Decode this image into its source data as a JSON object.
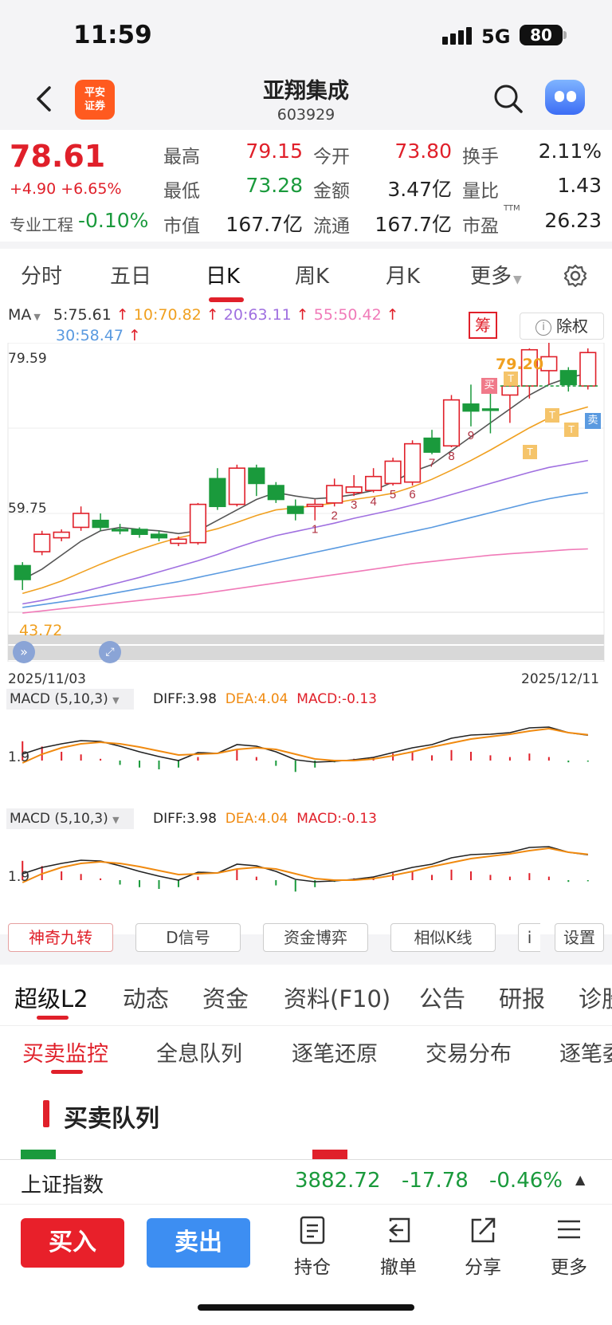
{
  "status": {
    "time": "11:59",
    "network": "5G",
    "battery": "80"
  },
  "header": {
    "logo_text_1": "平安",
    "logo_text_2": "证券",
    "stock_name": "亚翔集成",
    "stock_code": "603929"
  },
  "quote": {
    "price": "78.61",
    "change": "+4.90 +6.65%",
    "pro_label": "专业工程",
    "pro_value": "-0.10%",
    "fields": [
      {
        "label": "最高",
        "value": "79.15"
      },
      {
        "label": "今开",
        "value": "73.80"
      },
      {
        "label": "换手",
        "value": "2.11%"
      },
      {
        "label": "最低",
        "value": "73.28"
      },
      {
        "label": "金额",
        "value": "3.47亿"
      },
      {
        "label": "量比",
        "value": "1.43"
      },
      {
        "label": "市值",
        "value": "167.7亿"
      },
      {
        "label": "流通",
        "value": "167.7亿"
      },
      {
        "label": "市盈",
        "value": "26.23"
      }
    ],
    "ttm": "TTM"
  },
  "period_tabs": [
    "分时",
    "五日",
    "日K",
    "周K",
    "月K",
    "更多"
  ],
  "ma": {
    "label": "MA",
    "ma5": "5:75.61",
    "ma10": "10:70.82",
    "ma20": "20:63.11",
    "ma55": "55:50.42",
    "ma30": "30:58.47",
    "colors": {
      "ma5": "#555555",
      "ma10": "#f0a020",
      "ma20": "#a070e0",
      "ma55": "#f07ab8",
      "ma30": "#5a9ae0"
    }
  },
  "chart_buttons": {
    "chou": "筹",
    "chuquan": "除权"
  },
  "chart_data": {
    "type": "candlestick",
    "y_ticks": [
      "79.59",
      "59.75"
    ],
    "start_date": "2025/11/03",
    "end_date": "2025/12/11",
    "marks": {
      "high_label": "79.20",
      "low_label": "43.72",
      "buy": "买",
      "sell": "卖",
      "t": "T"
    },
    "count_labels": [
      "1",
      "2",
      "3",
      "4",
      "5",
      "6",
      "7",
      "8",
      "9"
    ],
    "candles": [
      {
        "o": 48.0,
        "c": 46.0,
        "h": 48.5,
        "l": 44.5
      },
      {
        "o": 50.0,
        "c": 52.5,
        "h": 53.0,
        "l": 49.5
      },
      {
        "o": 52.0,
        "c": 52.8,
        "h": 53.2,
        "l": 51.5
      },
      {
        "o": 53.5,
        "c": 55.5,
        "h": 56.5,
        "l": 53.0
      },
      {
        "o": 54.5,
        "c": 53.5,
        "h": 55.5,
        "l": 53.0
      },
      {
        "o": 53.2,
        "c": 53.0,
        "h": 54.0,
        "l": 52.5
      },
      {
        "o": 53.2,
        "c": 52.5,
        "h": 53.5,
        "l": 52.0
      },
      {
        "o": 52.5,
        "c": 52.0,
        "h": 53.0,
        "l": 51.5
      },
      {
        "o": 51.2,
        "c": 51.8,
        "h": 52.2,
        "l": 50.8
      },
      {
        "o": 51.3,
        "c": 56.8,
        "h": 57.0,
        "l": 51.0
      },
      {
        "o": 60.5,
        "c": 56.5,
        "h": 62.0,
        "l": 56.0
      },
      {
        "o": 56.8,
        "c": 62.0,
        "h": 62.5,
        "l": 56.5
      },
      {
        "o": 62.0,
        "c": 59.8,
        "h": 62.5,
        "l": 58.0
      },
      {
        "o": 59.5,
        "c": 57.5,
        "h": 60.0,
        "l": 57.0
      },
      {
        "o": 56.5,
        "c": 55.5,
        "h": 57.5,
        "l": 54.5
      },
      {
        "o": 56.5,
        "c": 56.8,
        "h": 57.5,
        "l": 54.5
      },
      {
        "o": 57.0,
        "c": 59.5,
        "h": 60.5,
        "l": 56.5
      },
      {
        "o": 58.5,
        "c": 59.3,
        "h": 61.0,
        "l": 58.0
      },
      {
        "o": 58.8,
        "c": 60.8,
        "h": 62.0,
        "l": 58.5
      },
      {
        "o": 59.8,
        "c": 63.0,
        "h": 63.5,
        "l": 59.5
      },
      {
        "o": 60.0,
        "c": 65.5,
        "h": 66.0,
        "l": 59.5
      },
      {
        "o": 66.3,
        "c": 64.3,
        "h": 67.5,
        "l": 64.0
      },
      {
        "o": 65.2,
        "c": 71.8,
        "h": 72.5,
        "l": 65.0
      },
      {
        "o": 71.2,
        "c": 70.2,
        "h": 74.0,
        "l": 68.0
      },
      {
        "o": 70.5,
        "c": 70.3,
        "h": 73.0,
        "l": 67.0
      },
      {
        "o": 72.5,
        "c": 73.8,
        "h": 74.5,
        "l": 68.5
      },
      {
        "o": 73.8,
        "c": 79.0,
        "h": 79.2,
        "l": 72.0
      },
      {
        "o": 76.0,
        "c": 78.0,
        "h": 80.0,
        "l": 74.0
      },
      {
        "o": 76.0,
        "c": 74.0,
        "h": 76.5,
        "l": 73.0
      },
      {
        "o": 73.8,
        "c": 78.6,
        "h": 79.2,
        "l": 73.3
      }
    ],
    "ma_series": {
      "ma5": [
        46,
        47.5,
        49.5,
        51.5,
        53.0,
        53.5,
        53.2,
        53.0,
        52.6,
        53.0,
        54.5,
        56.0,
        57.5,
        58.5,
        58.0,
        57.6,
        57.8,
        58.2,
        58.8,
        60.0,
        61.5,
        62.5,
        64.5,
        66.5,
        68.5,
        70.5,
        72.5,
        74.0,
        75.0,
        75.6
      ],
      "ma10": [
        44,
        44.8,
        45.8,
        47.0,
        48.2,
        49.3,
        50.3,
        51.2,
        52.0,
        52.6,
        53.3,
        54.2,
        55.2,
        56.0,
        56.3,
        56.6,
        57.0,
        57.5,
        57.9,
        58.4,
        59.3,
        60.4,
        61.7,
        63.1,
        64.6,
        66.2,
        67.8,
        69.2,
        70.0,
        70.8
      ],
      "ma20": [
        42.5,
        43.0,
        43.6,
        44.2,
        44.9,
        45.6,
        46.3,
        47.1,
        47.9,
        48.7,
        49.6,
        50.6,
        51.5,
        52.3,
        52.9,
        53.5,
        54.1,
        54.8,
        55.4,
        56.0,
        56.7,
        57.4,
        58.2,
        59.0,
        59.8,
        60.6,
        61.4,
        62.1,
        62.6,
        63.1
      ],
      "ma30": [
        42.0,
        42.4,
        42.8,
        43.2,
        43.7,
        44.2,
        44.7,
        45.2,
        45.7,
        46.3,
        46.9,
        47.5,
        48.1,
        48.7,
        49.3,
        49.9,
        50.5,
        51.1,
        51.7,
        52.3,
        52.9,
        53.5,
        54.2,
        54.9,
        55.6,
        56.3,
        57.0,
        57.6,
        58.1,
        58.5
      ],
      "ma55": [
        41.2,
        41.5,
        41.8,
        42.1,
        42.4,
        42.7,
        43.0,
        43.3,
        43.6,
        43.9,
        44.3,
        44.7,
        45.1,
        45.5,
        45.9,
        46.3,
        46.7,
        47.1,
        47.5,
        47.9,
        48.3,
        48.6,
        48.9,
        49.2,
        49.5,
        49.7,
        49.9,
        50.1,
        50.3,
        50.4
      ]
    }
  },
  "macd": {
    "label": "MACD (5,10,3)",
    "diff": "DIFF:3.98",
    "dea": "DEA:4.04",
    "macd": "MACD:-0.13",
    "axis_label": "1.9",
    "diff_series": [
      1.6,
      2.4,
      2.9,
      3.3,
      3.2,
      2.6,
      1.9,
      1.3,
      0.8,
      1.8,
      1.7,
      2.8,
      2.6,
      1.9,
      0.9,
      0.6,
      0.7,
      0.9,
      1.2,
      1.8,
      2.4,
      2.8,
      3.6,
      4.0,
      4.1,
      4.3,
      4.9,
      5.0,
      4.3,
      3.98
    ],
    "dea_series": [
      0.5,
      1.6,
      2.4,
      2.9,
      3.1,
      2.9,
      2.5,
      2.0,
      1.5,
      1.6,
      1.7,
      2.2,
      2.4,
      2.2,
      1.6,
      1.0,
      0.8,
      0.8,
      1.0,
      1.4,
      1.9,
      2.5,
      3.0,
      3.5,
      3.8,
      4.1,
      4.5,
      4.8,
      4.3,
      4.04
    ],
    "hist": [
      2.2,
      1.6,
      1.0,
      0.7,
      0.2,
      -0.5,
      -0.8,
      -1.0,
      -0.8,
      0.4,
      0.0,
      1.2,
      0.4,
      -0.6,
      -1.3,
      -0.8,
      -0.2,
      0.2,
      0.4,
      0.8,
      1.0,
      0.6,
      1.2,
      1.0,
      0.6,
      0.4,
      0.8,
      0.4,
      -0.2,
      -0.13
    ]
  },
  "tools": [
    "神奇九转",
    "D信号",
    "资金博弈",
    "相似K线",
    "i",
    "设置"
  ],
  "section_tabs": [
    "超级L2",
    "动态",
    "资金",
    "资料(F10)",
    "公告",
    "研报",
    "诊股"
  ],
  "sub_tabs": [
    "买卖监控",
    "全息队列",
    "逐笔还原",
    "交易分布",
    "逐笔委托"
  ],
  "queue_title": "买卖队列",
  "index": {
    "name": "上证指数",
    "value": "3882.72",
    "change": "-17.78",
    "pct": "-0.46%"
  },
  "bottom": {
    "buy": "买入",
    "sell": "卖出",
    "actions": [
      "持仓",
      "撤单",
      "分享",
      "更多"
    ]
  }
}
